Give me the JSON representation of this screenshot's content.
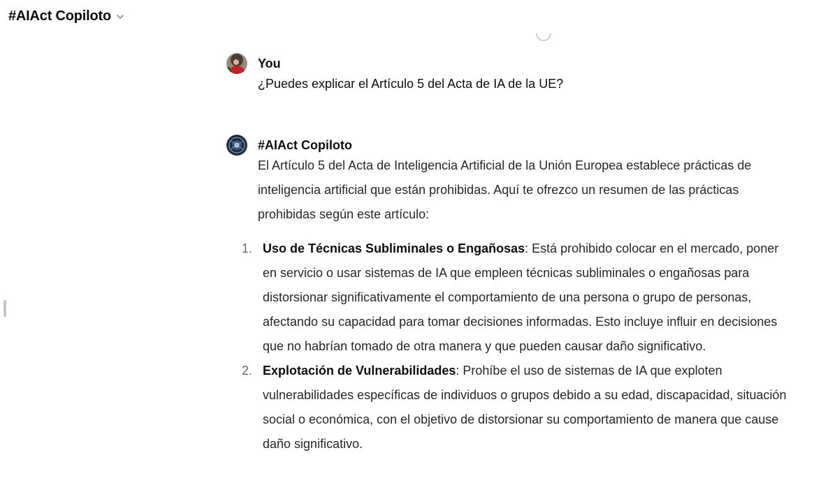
{
  "header": {
    "title": "#AIAct Copiloto",
    "dropdown_icon": "chevron-down-icon"
  },
  "conversation": {
    "user_message": {
      "author": "You",
      "text": "¿Puedes explicar el Artículo 5 del Acta de IA de la UE?"
    },
    "assistant_message": {
      "author": "#AIAct Copiloto",
      "intro": "El Artículo 5 del Acta de Inteligencia Artificial de la Unión Europea establece prácticas de inteligencia artificial que están prohibidas. Aquí te ofrezco un resumen de las prácticas prohibidas según este artículo:",
      "items": [
        {
          "number": "1.",
          "title": "Uso de Técnicas Subliminales o Engañosas",
          "text": ": Está prohibido colocar en el mercado, poner en servicio o usar sistemas de IA que empleen técnicas subliminales o engañosas para distorsionar significativamente el comportamiento de una persona o grupo de personas, afectando su capacidad para tomar decisiones informadas. Esto incluye influir en decisiones que no habrían tomado de otra manera y que pueden causar daño significativo."
        },
        {
          "number": "2.",
          "title": "Explotación de Vulnerabilidades",
          "text": ": Prohíbe el uso de sistemas de IA que exploten vulnerabilidades específicas de individuos o grupos debido a su edad, discapacidad, situación social o económica, con el objetivo de distorsionar su comportamiento de manera que cause daño significativo."
        }
      ]
    }
  },
  "colors": {
    "text_primary": "#0d0d0d",
    "text_body": "#262626",
    "list_number": "#6b6b6b"
  }
}
